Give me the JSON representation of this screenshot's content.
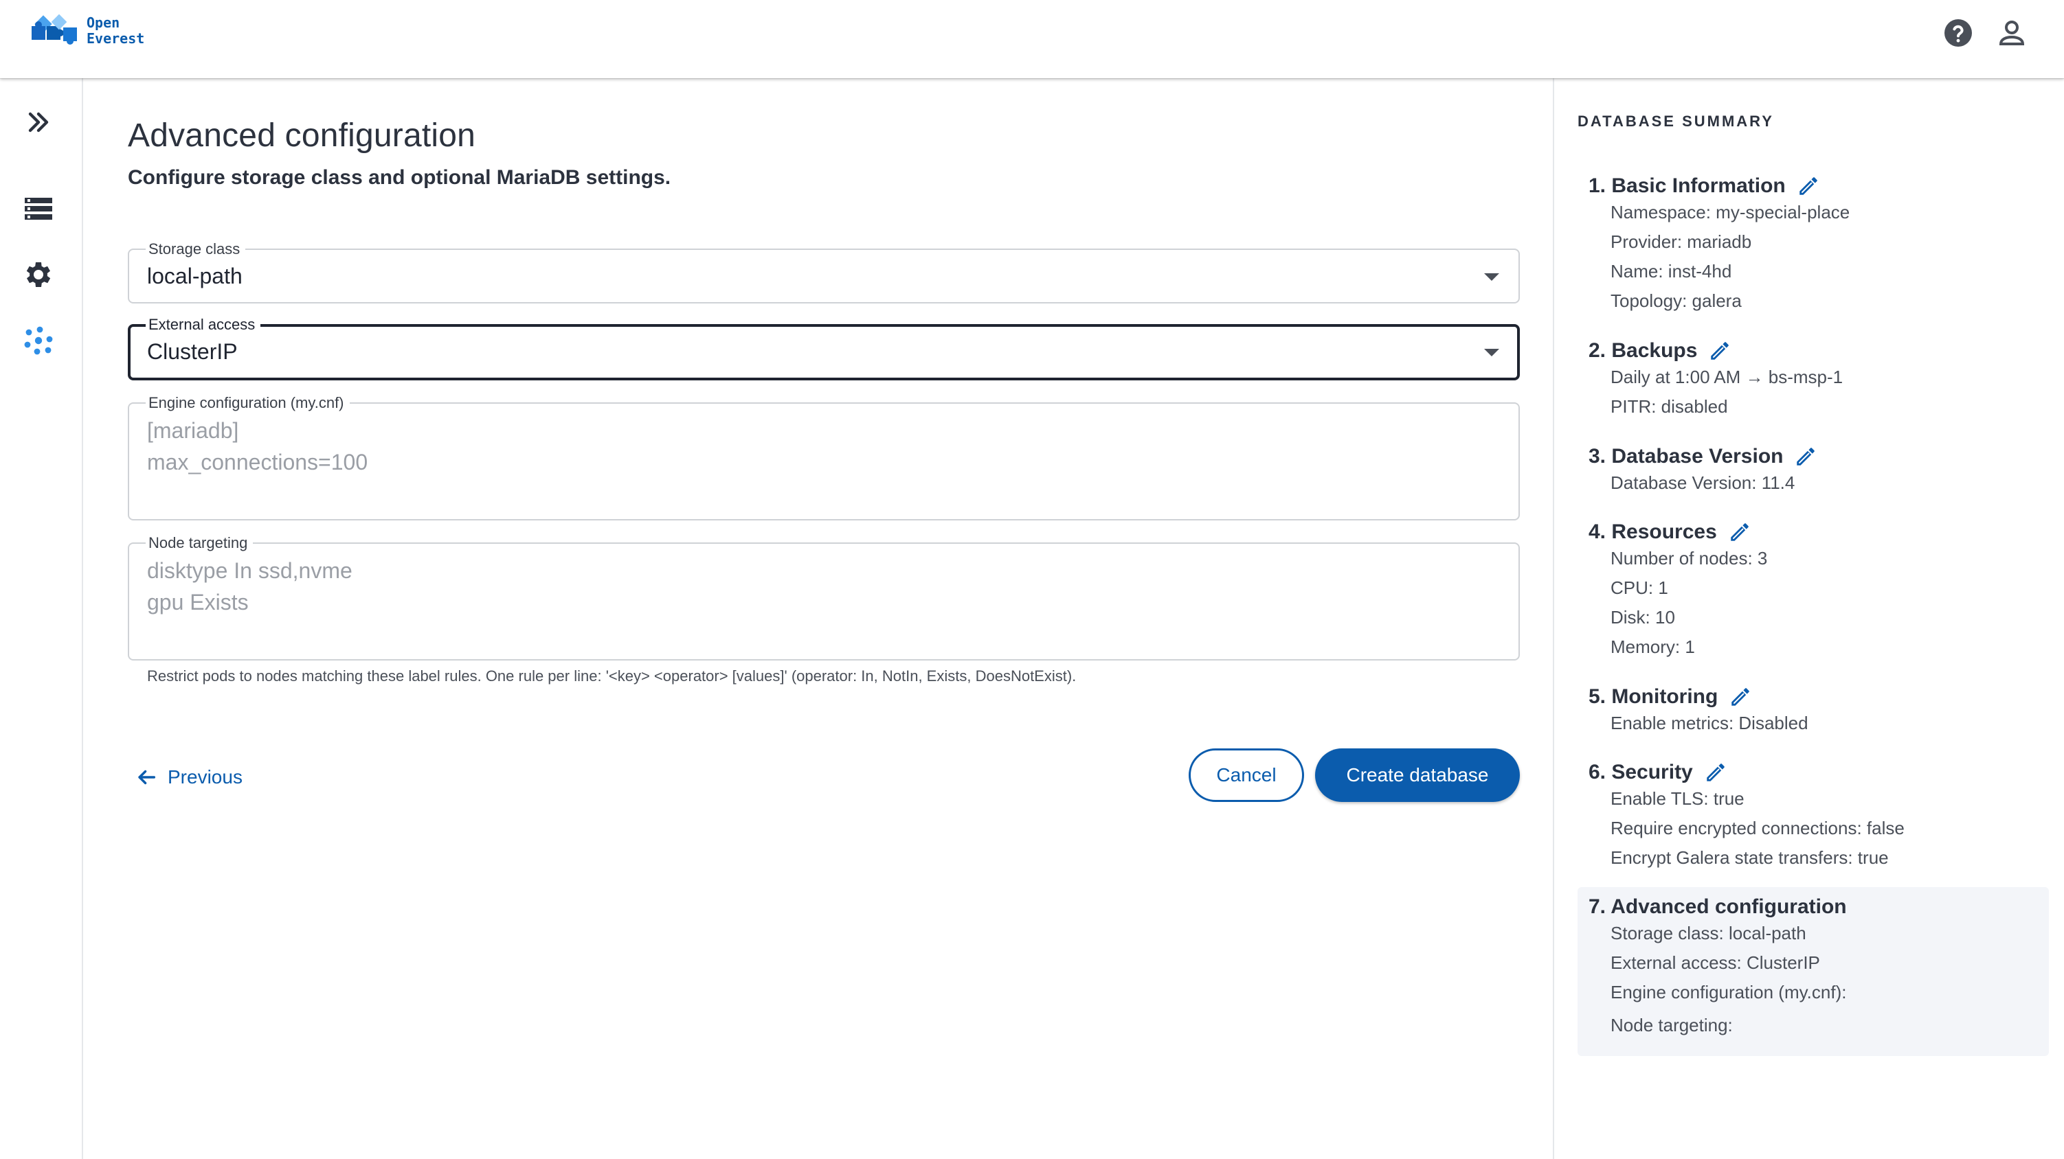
{
  "brand": {
    "line1": "Open",
    "line2": "Everest"
  },
  "header_icons": [
    "help-icon",
    "account-icon"
  ],
  "sidebar": {
    "icons": [
      "expand-icon",
      "databases-icon",
      "settings-icon",
      "cluster-icon"
    ]
  },
  "page": {
    "title": "Advanced configuration",
    "subtitle": "Configure storage class and optional MariaDB settings."
  },
  "form": {
    "storage_class": {
      "label": "Storage class",
      "value": "local-path"
    },
    "external_access": {
      "label": "External access",
      "value": "ClusterIP"
    },
    "engine_config": {
      "label": "Engine configuration (my.cnf)",
      "placeholder_lines": [
        "[mariadb]",
        "max_connections=100"
      ]
    },
    "node_targeting": {
      "label": "Node targeting",
      "placeholder_lines": [
        "disktype In ssd,nvme",
        "gpu Exists"
      ],
      "helper": "Restrict pods to nodes matching these label rules. One rule per line: '<key> <operator> [values]' (operator: In, NotIn, Exists, DoesNotExist)."
    }
  },
  "actions": {
    "previous": "Previous",
    "cancel": "Cancel",
    "create": "Create database"
  },
  "summary": {
    "title": "DATABASE SUMMARY",
    "sections": [
      {
        "title": "1. Basic Information",
        "editable": true,
        "lines": [
          "Namespace: my-special-place",
          "Provider: mariadb",
          "Name: inst-4hd",
          "Topology: galera"
        ]
      },
      {
        "title": "2. Backups",
        "editable": true,
        "lines": [
          "Daily at 1:00 AM → bs-msp-1",
          "PITR: disabled"
        ]
      },
      {
        "title": "3. Database Version",
        "editable": true,
        "lines": [
          "Database Version: 11.4"
        ]
      },
      {
        "title": "4. Resources",
        "editable": true,
        "lines": [
          "Number of nodes: 3",
          "CPU: 1",
          "Disk: 10",
          "Memory: 1"
        ]
      },
      {
        "title": "5. Monitoring",
        "editable": true,
        "lines": [
          "Enable metrics: Disabled"
        ]
      },
      {
        "title": "6. Security",
        "editable": true,
        "lines": [
          "Enable TLS: true",
          "Require encrypted connections: false",
          "Encrypt Galera state transfers: true"
        ]
      },
      {
        "title": "7. Advanced configuration",
        "editable": false,
        "lines": [
          "Storage class: local-path",
          "External access: ClusterIP",
          "Engine configuration (my.cnf):",
          "Node targeting:"
        ]
      }
    ]
  },
  "colors": {
    "primary": "#0b5cad",
    "accent_light": "#2e8ee6",
    "text": "#2c323e",
    "active_bg": "#f3f5f9"
  }
}
